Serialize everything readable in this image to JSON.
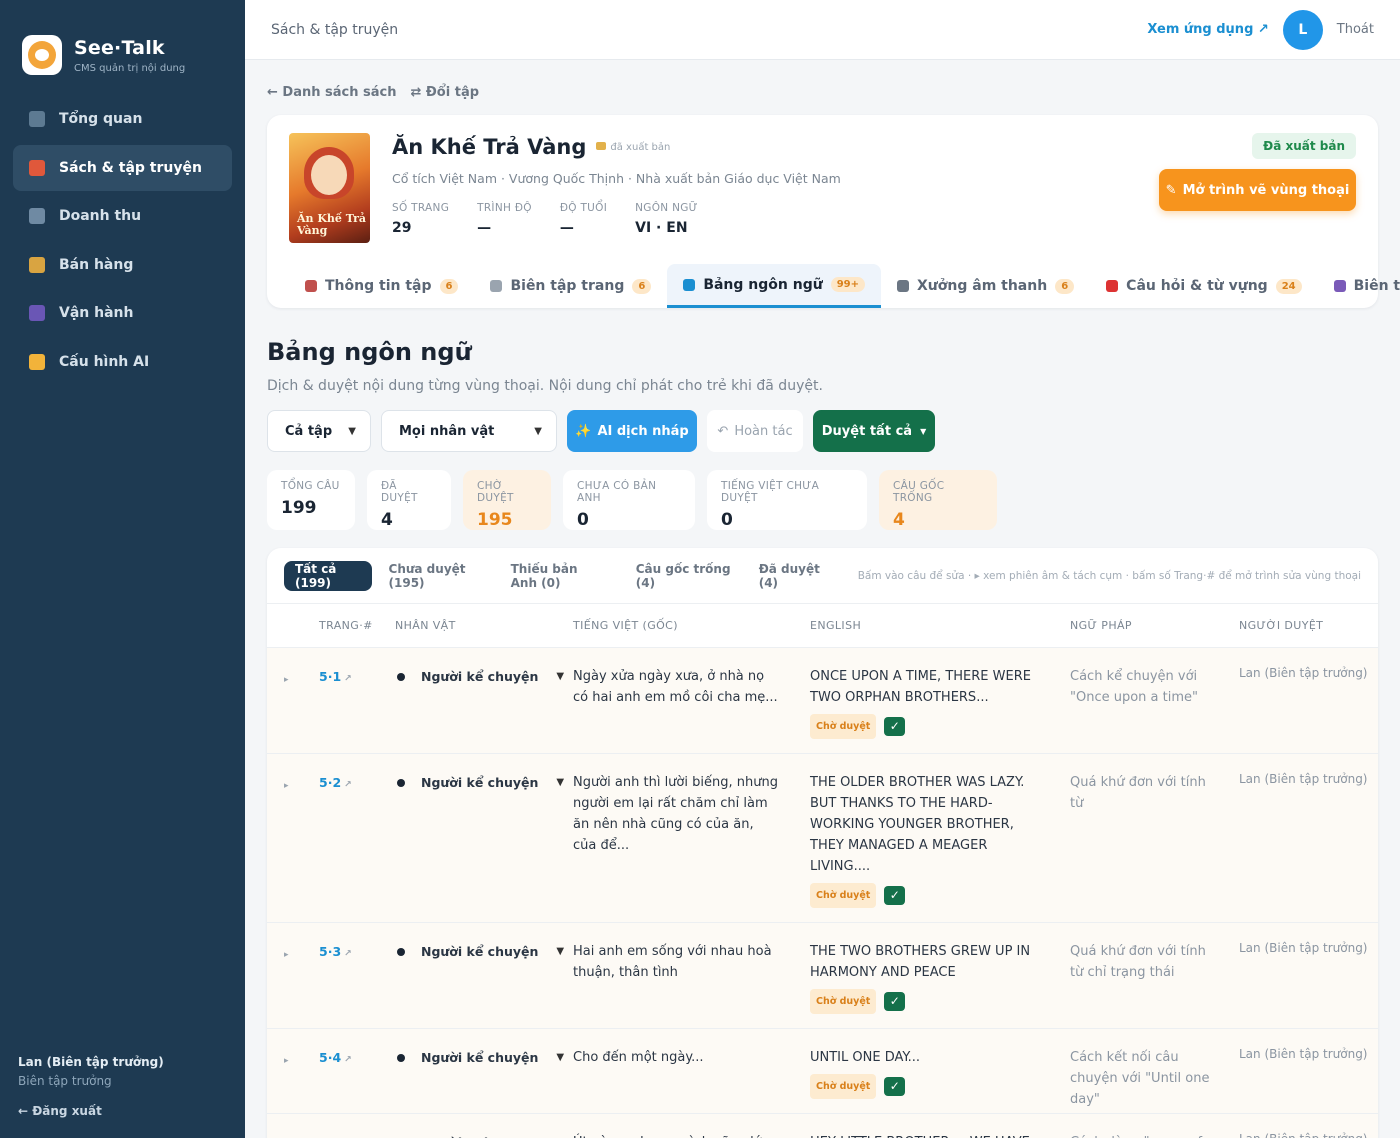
{
  "brand": {
    "name": "See·Talk",
    "subtitle": "CMS quản trị nội dung"
  },
  "sidebar": {
    "items": [
      {
        "label": "Tổng quan",
        "icon": "grid-icon",
        "color": "#5d7a92"
      },
      {
        "label": "Sách & tập truyện",
        "icon": "books-icon",
        "color": "#e0583b",
        "active": true
      },
      {
        "label": "Doanh thu",
        "icon": "chart-icon",
        "color": "#6f8aa3"
      },
      {
        "label": "Bán hàng",
        "icon": "tag-icon",
        "color": "#d9a441"
      },
      {
        "label": "Vận hành",
        "icon": "people-icon",
        "color": "#6a56b5"
      },
      {
        "label": "Cấu hình AI",
        "icon": "sparkle-icon",
        "color": "#f2b33a"
      }
    ],
    "user_name": "Lan (Biên tập trưởng)",
    "user_role": "Biên tập trưởng",
    "logout": "← Đăng xuất"
  },
  "topbar": {
    "title": "Sách & tập truyện",
    "view_app": "Xem ứng dụng ↗",
    "avatar_letter": "L",
    "logout": "Thoát"
  },
  "breadcrumbs": {
    "back": "← Danh sách sách",
    "switch": "⇄ Đổi tập"
  },
  "book": {
    "title": "Ăn Khế Trả Vàng",
    "published_mini": "đã xuất bản",
    "meta": "Cổ tích Việt Nam · Vương Quốc Thịnh · Nhà xuất bản Giáo dục Việt Nam",
    "cover_text": "Ăn Khế Trả Vàng",
    "stats": [
      {
        "label": "SỐ TRANG",
        "value": "29"
      },
      {
        "label": "TRÌNH ĐỘ",
        "value": "—"
      },
      {
        "label": "ĐỘ TUỔI",
        "value": "—"
      },
      {
        "label": "NGÔN NGỮ",
        "value": "VI · EN"
      }
    ],
    "status_badge": "Đã xuất bản",
    "open_editor": "Mở trình vẽ vùng thoại"
  },
  "tabs": [
    {
      "label": "Thông tin tập",
      "badge": "6",
      "color": "#c0504d"
    },
    {
      "label": "Biên tập trang",
      "badge": "6",
      "color": "#9aa4af"
    },
    {
      "label": "Bảng ngôn ngữ",
      "badge": "99+",
      "color": "#1b8fd1",
      "active": true
    },
    {
      "label": "Xưởng âm thanh",
      "badge": "6",
      "color": "#6b7683"
    },
    {
      "label": "Câu hỏi & từ vựng",
      "badge": "24",
      "color": "#d33"
    },
    {
      "label": "Biên tập trò",
      "badge": "",
      "color": "#7a5ab8"
    }
  ],
  "section": {
    "title": "Bảng ngôn ngữ",
    "subtitle": "Dịch & duyệt nội dung từng vùng thoại. Nội dung chỉ phát cho trẻ khi đã duyệt."
  },
  "toolbar": {
    "scope": "Cả tập",
    "character": "Mọi nhân vật",
    "ai_translate": "AI dịch nháp",
    "undo": "Hoàn tác",
    "approve_all": "Duyệt tất cả"
  },
  "stats": [
    {
      "label": "TỔNG CÂU",
      "value": "199",
      "warn": false
    },
    {
      "label": "ĐÃ DUYỆT",
      "value": "4",
      "warn": false
    },
    {
      "label": "CHỜ DUYỆT",
      "value": "195",
      "warn": true
    },
    {
      "label": "CHƯA CÓ BẢN ANH",
      "value": "0",
      "warn": false
    },
    {
      "label": "TIẾNG VIỆT CHƯA DUYỆT",
      "value": "0",
      "warn": false
    },
    {
      "label": "CÂU GỐC TRỐNG",
      "value": "4",
      "warn": true
    }
  ],
  "filters": [
    {
      "label": "Tất cả (199)",
      "active": true
    },
    {
      "label": "Chưa duyệt (195)"
    },
    {
      "label": "Thiếu bản Anh (0)"
    },
    {
      "label": "Câu gốc trống (4)"
    },
    {
      "label": "Đã duyệt (4)"
    }
  ],
  "hint": "Bấm vào câu để sửa · ▸ xem phiên âm & tách cụm · bấm số Trang·# để mở trình sửa vùng thoại",
  "columns": [
    "TRANG·#",
    "NHÂN VẬT",
    "TIẾNG VIỆT (GỐC)",
    "ENGLISH",
    "NGỮ PHÁP",
    "NGƯỜI DUYỆT"
  ],
  "rows": [
    {
      "page": "5·1",
      "character": "Người kể chuyện",
      "vi": "Ngày xửa ngày xưa, ở nhà nọ có hai anh em mồ côi cha mẹ...",
      "en": "ONCE UPON A TIME, THERE WERE TWO ORPHAN BROTHERS...",
      "status": "Chờ duyệt",
      "grammar": "Cách kể chuyện với \"Once upon a time\"",
      "reviewer": "Lan (Biên tập trưởng)"
    },
    {
      "page": "5·2",
      "character": "Người kể chuyện",
      "vi": "Người anh thì lười biếng, nhưng người em lại rất chăm chỉ làm ăn nên nhà cũng có của ăn, của để...",
      "en": "THE OLDER BROTHER WAS LAZY. BUT THANKS TO THE HARD-WORKING YOUNGER BROTHER, THEY MANAGED A MEAGER LIVING....",
      "status": "Chờ duyệt",
      "grammar": "Quá khứ đơn với tính từ",
      "reviewer": "Lan (Biên tập trưởng)"
    },
    {
      "page": "5·3",
      "character": "Người kể chuyện",
      "vi": "Hai anh em sống với nhau hoà thuận, thân tình",
      "en": "THE TWO BROTHERS GREW UP IN HARMONY AND PEACE",
      "status": "Chờ duyệt",
      "grammar": "Quá khứ đơn với tính từ chỉ trạng thái",
      "reviewer": "Lan (Biên tập trưởng)"
    },
    {
      "page": "5·4",
      "character": "Người kể chuyện",
      "vi": "Cho đến một ngày...",
      "en": "UNTIL ONE DAY...",
      "status": "Chờ duyệt",
      "grammar": "Cách kết nối câu chuyện với \"Until one day\"",
      "reviewer": "Lan (Biên tập trưởng)"
    },
    {
      "page": "5·5",
      "character": "Người anh",
      "vi": "Út này, anh em mình cũng lớn tuổi rồi...",
      "en": "HEY LITTLE BROTHER..., WE HAVE COME OF AGE",
      "status": "",
      "grammar": "Cách dùng \"come of age\"",
      "reviewer": "Lan (Biên tập trưởng)"
    }
  ]
}
